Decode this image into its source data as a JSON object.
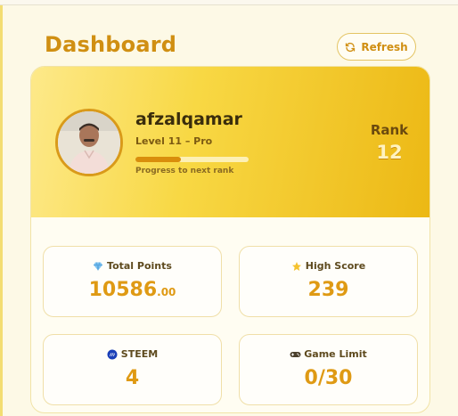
{
  "header": {
    "title": "Dashboard",
    "refresh_label": "Refresh"
  },
  "profile": {
    "username": "afzalqamar",
    "level": "Level 11 – Pro",
    "progress_fraction": 0.4,
    "progress_label": "Progress to next rank",
    "rank_label": "Rank",
    "rank_value": "12"
  },
  "stats": {
    "total_points": {
      "label": "Total Points",
      "icon": "gem-icon",
      "value_int": "10586",
      "value_dec": ".00"
    },
    "high_score": {
      "label": "High Score",
      "icon": "star-icon",
      "value": "239"
    },
    "steem": {
      "label": "STEEM",
      "icon": "steem-icon",
      "value": "4"
    },
    "game_limit": {
      "label": "Game Limit",
      "icon": "gamepad-icon",
      "value": "0/30"
    }
  },
  "colors": {
    "accent": "#d08f12",
    "value": "#df9a14",
    "hero_start": "#fde98a",
    "hero_end": "#ecb814"
  }
}
